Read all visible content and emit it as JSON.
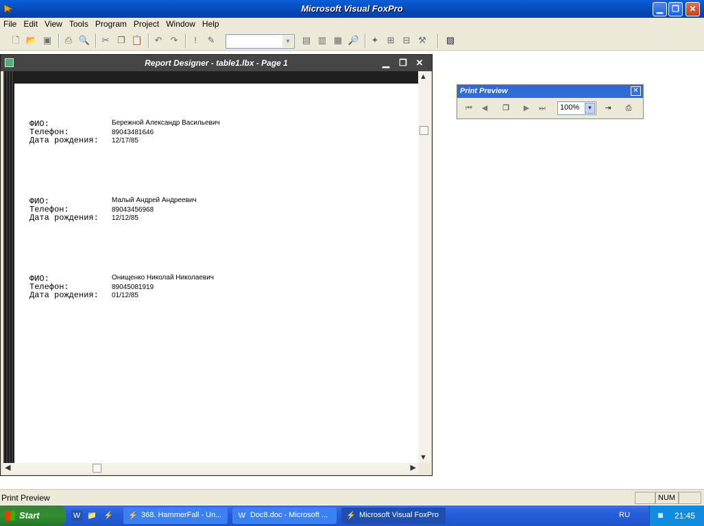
{
  "app": {
    "title": "Microsoft Visual FoxPro"
  },
  "menu": [
    "File",
    "Edit",
    "View",
    "Tools",
    "Program",
    "Project",
    "Window",
    "Help"
  ],
  "toolbar": {
    "combo_value": ""
  },
  "report_designer": {
    "title": "Report Designer - table1.lbx - Page 1",
    "records": [
      {
        "fio_label": "ФИО:",
        "phone_label": "Телефон:",
        "dob_label": "Дата рождения:",
        "fio": "Бережной Александр Васильевич",
        "phone": "89043481646",
        "dob": "12/17/85"
      },
      {
        "fio_label": "ФИО:",
        "phone_label": "Телефон:",
        "dob_label": "Дата рождения:",
        "fio": "Малый Андрей Андреевич",
        "phone": "89043456968",
        "dob": "12/12/85"
      },
      {
        "fio_label": "ФИО:",
        "phone_label": "Телефон:",
        "dob_label": "Дата рождения:",
        "fio": "Онищенко Николай Николаевич",
        "phone": "89045081919",
        "dob": "01/12/85"
      }
    ]
  },
  "print_preview": {
    "title": "Print Preview",
    "zoom": "100%"
  },
  "statusbar": {
    "text": "Print Preview",
    "num": "NUM"
  },
  "taskbar": {
    "start": "Start",
    "tasks": [
      {
        "label": "368. HammerFall - Un..."
      },
      {
        "label": "Doc8.doc - Microsoft ..."
      },
      {
        "label": "Microsoft Visual FoxPro"
      }
    ],
    "lang": "RU",
    "clock": "21:45"
  },
  "icons": [
    "foxpro-icon",
    "new-icon",
    "open-icon",
    "save-icon",
    "print-icon",
    "print-preview-icon",
    "cut-icon",
    "copy-icon",
    "paste-icon",
    "undo-icon",
    "redo-icon",
    "run-icon",
    "modify-icon",
    "first-page-icon",
    "prev-page-icon",
    "multi-page-icon",
    "next-page-icon",
    "last-page-icon",
    "close-preview-icon",
    "printer-icon"
  ]
}
